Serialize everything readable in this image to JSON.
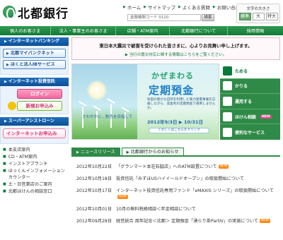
{
  "header": {
    "logo_text": "北都銀行",
    "topnav": [
      {
        "label": "ホーム"
      },
      {
        "label": "サイトマップ"
      },
      {
        "label": "よくある質問"
      },
      {
        "label": "お問い合わせ"
      }
    ],
    "code_search_placeholder": "金融機関コード 0120",
    "search_button": "検索",
    "font_size": {
      "label": "文字の大きさ",
      "options": [
        "標準",
        "大",
        "特大"
      ]
    }
  },
  "gnav": [
    {
      "label": "個人のお客さま"
    },
    {
      "label": "法人・事業主のお客さま"
    },
    {
      "label": "店舗・ATM案内"
    },
    {
      "label": "北都銀行について"
    },
    {
      "label": "採用情報"
    }
  ],
  "left": {
    "internet_banking": {
      "title": "インターネットバンキング",
      "buttons": [
        "北都マイバンクネット",
        "ほくと法人IBサービス"
      ]
    },
    "investment": {
      "title": "インターネット投資信託",
      "login": "ログイン",
      "new_apply": "新規お申込み"
    },
    "super_assist": {
      "title": "スーパーアシストローン",
      "button": "インターネットお申込み"
    },
    "links": [
      "本支店案内",
      "CD・ATM案内",
      "インストアブランチ",
      "ほっくんインフォメーションカウンター",
      "土・日営業店のご案内",
      "北都ほけんの相談窓口"
    ]
  },
  "notice": {
    "line1": "東日本大震災で被害を受けられた皆さまに、心よりお見舞い申し上げます。",
    "line2": "▶ 当行の震災対応に関する情報はこちらをご覧ください。"
  },
  "banner": {
    "caption": "さわやかに…秋色を目指して",
    "title1": "かぜまわる",
    "title2": "定期預金",
    "description": "秋田の豊かな自然を利用した風力発電事業を応援しながら、高金利の定期預金で運用しませんか。",
    "dates": "2012年9/3日 ▶ 10/31日",
    "more": "くわしくはこちらをクリック"
  },
  "vmenu": [
    {
      "label": "ためる",
      "badge": "",
      "active": true
    },
    {
      "label": "かりる",
      "badge": "",
      "active": false
    },
    {
      "label": "運用する",
      "badge": "",
      "active": false
    },
    {
      "label": "ほけん相談",
      "badge": "NEW",
      "active": false
    },
    {
      "label": "便利なサービス",
      "badge": "",
      "active": false
    }
  ],
  "news": {
    "tabs": [
      "ニュースリリース",
      "北都銀行からのお知らせ"
    ],
    "items": [
      {
        "date": "2012年10月22日",
        "text": "「グランマート本荘石脇店」へのATM設置について",
        "new": true
      },
      {
        "date": "2012年10月18日",
        "text": "投資信託「みずほUSハイイールドオープン」の取扱開始について",
        "new": false
      },
      {
        "date": "2012年10月17日",
        "text": "インターネット投資信託専用ファンド「eMAXIS シリーズ」の取扱開始について",
        "new": true
      },
      {
        "date": "2012年10月01日",
        "text": "10月の無料税務相談＜年金相談について",
        "new": false
      },
      {
        "date": "2012年09月28日",
        "text": "経営統合 周年記念＜北都＞ 定期預金「湧らり茶PartⅣ」の実施について",
        "new": true
      }
    ]
  }
}
